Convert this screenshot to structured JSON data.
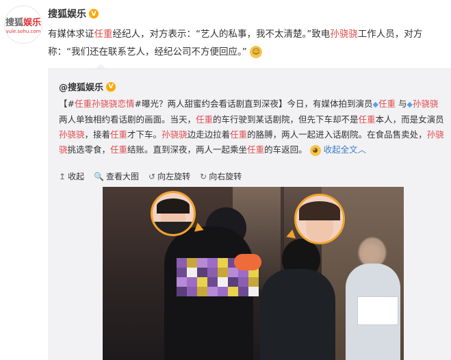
{
  "author": {
    "name": "搜狐娱乐",
    "logo_main_a": "搜狐",
    "logo_main_b": "娱乐",
    "logo_sub": "yule.sohu.com",
    "verified_icon": "V"
  },
  "post": {
    "line1_a": "有媒体求证",
    "line1_hl": "任重",
    "line1_b": "经纪人，对方表示：“艺人的私事，我不太清楚。”致电",
    "line1_hl2": "孙骁骁",
    "line1_c": "工作人员，对方",
    "line2": "称：“我们还在联系艺人，经纪公司不方便回应。”",
    "emoji_icon": "smirk-emoji"
  },
  "repost": {
    "author": "@搜狐娱乐",
    "verified_icon": "V",
    "text": {
      "t1": "【#",
      "t2": "任重孙骁骁恋情",
      "t3": "#曝光？两人甜蜜约会看话剧直到深夜】今日，有媒体拍到演员",
      "t4": "任重",
      "t5": " 与",
      "t6": "孙骁骁",
      "t7": " 两人单独相约看话剧的画面。当天，",
      "t8": "任重",
      "t9": "的车行驶到某话剧院，但先下车却不是",
      "t10": "任重",
      "t11": "本人，而是女演员",
      "t12": "孙骁骁",
      "t13": "，接着",
      "t14": "任重",
      "t15": "才下车。",
      "t16": "孙骁骁",
      "t17": "边走边拉着",
      "t18": "任重",
      "t19": "的胳膊，两人一起进入话剧院。在食品售卖处，",
      "t20": "孙骁骁",
      "t21": "挑选零食，",
      "t22": "任重",
      "t23": "结账。直到深夜，两人一起乘坐",
      "t24": "任重",
      "t25": "的车返回。",
      "expand": "收起全文",
      "expand_arrow": "︿"
    },
    "actions": [
      {
        "icon": "↥",
        "label": "收起"
      },
      {
        "icon": "🔍",
        "label": "查看大图"
      },
      {
        "icon": "↺",
        "label": "向左旋转"
      },
      {
        "icon": "↻",
        "label": "向右旋转"
      }
    ]
  }
}
